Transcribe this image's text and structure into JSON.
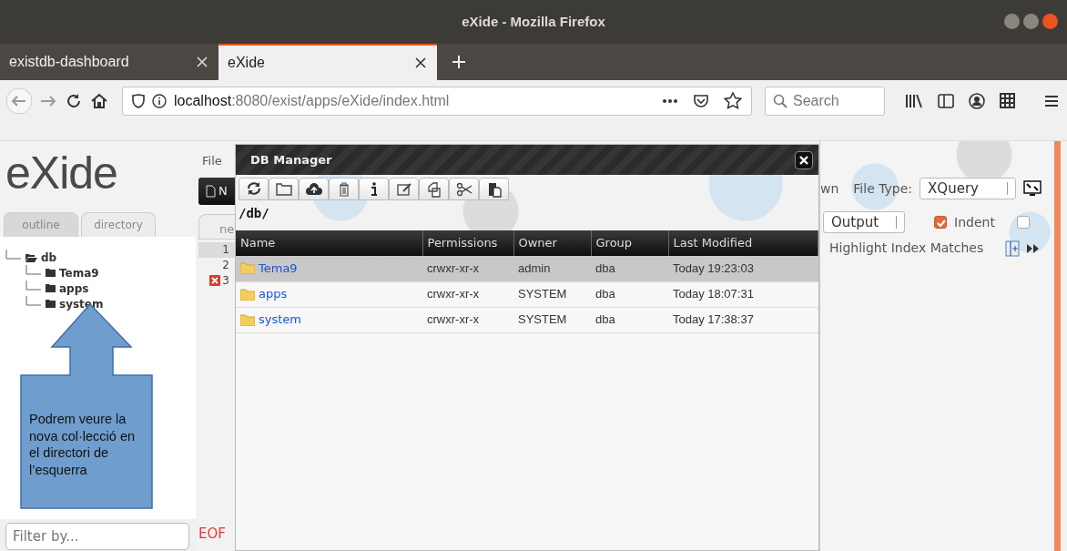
{
  "window": {
    "title": "eXide - Mozilla Firefox"
  },
  "browser_tabs": [
    {
      "label": "existdb-dashboard",
      "selected": false
    },
    {
      "label": "eXide",
      "selected": true
    }
  ],
  "address_bar": {
    "host": "localhost",
    "path": ":8080/exist/apps/eXide/index.html"
  },
  "search": {
    "placeholder": "Search"
  },
  "app": {
    "logo": "eXide",
    "menu": [
      "File"
    ],
    "new_button": "N",
    "side_tabs": [
      {
        "label": "outline",
        "selected": true
      },
      {
        "label": "directory",
        "selected": false
      }
    ],
    "tree": [
      {
        "label": "db",
        "expanded": true,
        "children": [
          {
            "label": "Tema9",
            "expanded": false
          },
          {
            "label": "apps",
            "expanded": false
          },
          {
            "label": "system",
            "expanded": false
          }
        ]
      }
    ],
    "filter": {
      "placeholder": "Filter by..."
    },
    "editor_tab": "ne",
    "lines": [
      {
        "number": "1",
        "current": true,
        "error": false
      },
      {
        "number": "2",
        "current": false,
        "error": false
      },
      {
        "number": "3",
        "current": false,
        "error": true
      }
    ],
    "error_text": "EOF",
    "toolbar_text": "wn",
    "file_type_label": "File Type:",
    "file_type": "XQuery",
    "output_select": "Output",
    "indent": {
      "label": "Indent",
      "checked": true
    },
    "extra_checkbox": {
      "checked": false
    },
    "highlight_label": "Highlight Index Matches"
  },
  "dialog": {
    "title": "DB Manager",
    "path": "/db/",
    "columns": [
      "Name",
      "Permissions",
      "Owner",
      "Group",
      "Last Modified"
    ],
    "rows": [
      {
        "name": "Tema9",
        "permissions": "crwxr-xr-x",
        "owner": "admin",
        "group": "dba",
        "last_modified": "Today 19:23:03",
        "selected": true
      },
      {
        "name": "apps",
        "permissions": "crwxr-xr-x",
        "owner": "SYSTEM",
        "group": "dba",
        "last_modified": "Today 18:07:31",
        "selected": false
      },
      {
        "name": "system",
        "permissions": "crwxr-xr-x",
        "owner": "SYSTEM",
        "group": "dba",
        "last_modified": "Today 17:38:37",
        "selected": false
      }
    ]
  },
  "callout": {
    "text": "Podrem veure la nova col·lecció en el directori de l’esquerra"
  }
}
